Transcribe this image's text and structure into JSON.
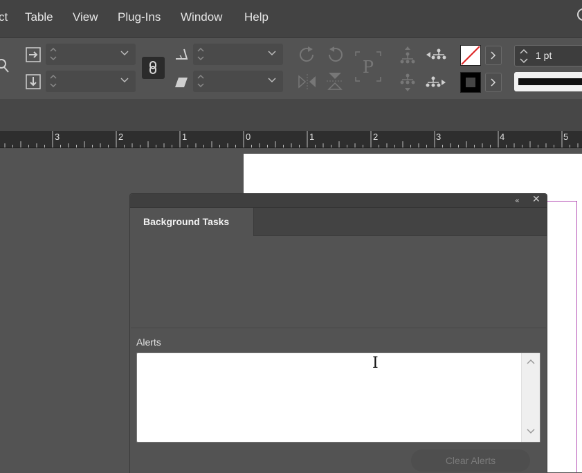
{
  "menubar": {
    "items": [
      "ct",
      "Table",
      "View",
      "Plug-Ins",
      "Window",
      "Help"
    ]
  },
  "controlbar": {
    "stroke_weight": "1 pt"
  },
  "ruler": {
    "labels": [
      "3",
      "2",
      "1",
      "0",
      "1",
      "2",
      "3",
      "4",
      "5"
    ]
  },
  "panel": {
    "tab_label": "Background Tasks",
    "alerts_label": "Alerts",
    "clear_button": "Clear Alerts",
    "collapse_icon": "double-chevron-left-icon",
    "close_icon": "close-icon"
  },
  "colors": {
    "menubar_bg": "#434343",
    "panel_bg": "#535353",
    "page_bg": "#ffffff",
    "margin_guide": "#b44fb4"
  }
}
